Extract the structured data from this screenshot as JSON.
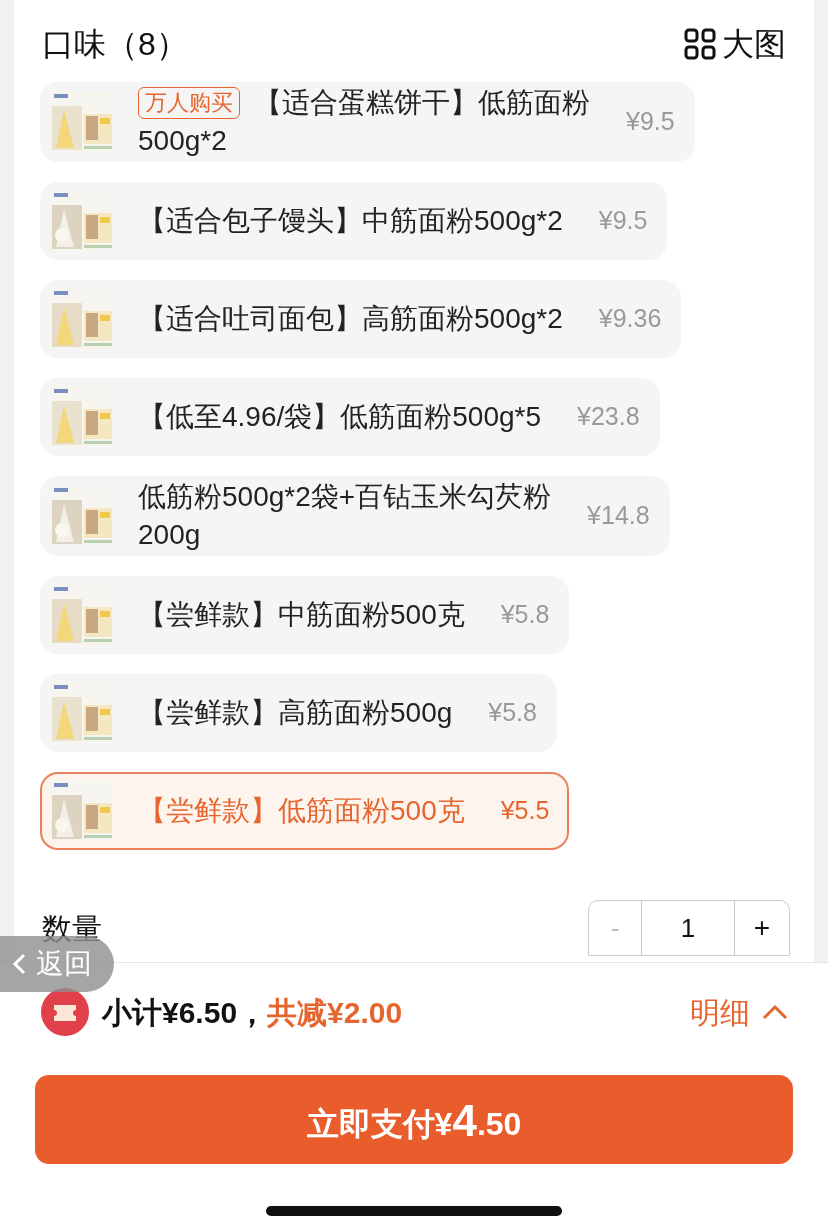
{
  "header": {
    "title": "口味（8）",
    "view_toggle": "大图"
  },
  "options": [
    {
      "badge": "万人购买",
      "lines": [
        "【适合蛋糕饼干】低筋面粉",
        "500g*2"
      ],
      "price": "¥9.5",
      "selected": false
    },
    {
      "lines": [
        "【适合包子馒头】中筋面粉500g*2"
      ],
      "price": "¥9.5",
      "selected": false
    },
    {
      "lines": [
        "【适合吐司面包】高筋面粉500g*2"
      ],
      "price": "¥9.36",
      "selected": false
    },
    {
      "lines": [
        "【低至4.96/袋】低筋面粉500g*5"
      ],
      "price": "¥23.8",
      "selected": false
    },
    {
      "lines": [
        "低筋粉500g*2袋+百钻玉米勾芡粉",
        "200g"
      ],
      "price": "¥14.8",
      "selected": false
    },
    {
      "lines": [
        "【尝鲜款】中筋面粉500克"
      ],
      "price": "¥5.8",
      "selected": false
    },
    {
      "lines": [
        "【尝鲜款】高筋面粉500g"
      ],
      "price": "¥5.8",
      "selected": false
    },
    {
      "lines": [
        "【尝鲜款】低筋面粉500克"
      ],
      "price": "¥5.5",
      "selected": true
    }
  ],
  "quantity": {
    "label": "数量",
    "decrease": "-",
    "value": "1",
    "increase": "+",
    "decrease_disabled": true
  },
  "back_button": "返回",
  "summary": {
    "subtotal": "小计¥6.50，",
    "discount": "共减¥2.00",
    "details": "明细"
  },
  "pay_button": {
    "prefix": "立即支付¥",
    "major": "4",
    "minor": ".50"
  }
}
